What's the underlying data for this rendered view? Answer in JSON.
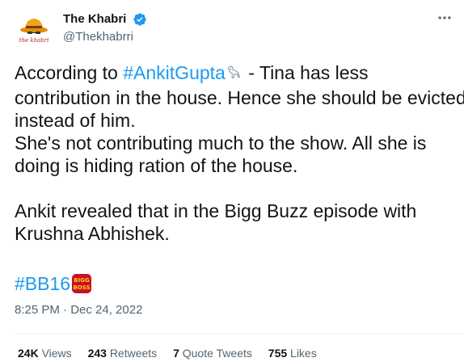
{
  "author": {
    "display_name": "The Khabri",
    "handle": "@Thekhabrri",
    "avatar_logo_text": "the khabri",
    "verified": true
  },
  "tweet": {
    "line1_pre": "According to ",
    "line1_tag": "#AnkitGupta",
    "line1_emoji": "goat-emoji",
    "line1_post": " - Tina has less",
    "line2": "contribution in the house. Hence she should be evicted",
    "line3": "instead of him.",
    "line4": "She's not contributing much to the show. All she is",
    "line5": "doing is hiding ration of the house.",
    "line6": "Ankit revealed that in the Bigg Buzz episode with",
    "line7": "Krushna Abhishek.",
    "hashtag": "#BB16",
    "hashtag_emoji": "bigg-boss-logo",
    "hashtag_emoji_text": "BIGG BOSS"
  },
  "timestamp": "8:25 PM · Dec 24, 2022",
  "stats": {
    "views_count": "24K",
    "views_label": "Views",
    "retweets_count": "243",
    "retweets_label": "Retweets",
    "quotes_count": "7",
    "quotes_label": "Quote Tweets",
    "likes_count": "755",
    "likes_label": "Likes"
  },
  "colors": {
    "link": "#1d9bf0",
    "secondary_text": "#536471",
    "verified": "#1d9bf0"
  }
}
